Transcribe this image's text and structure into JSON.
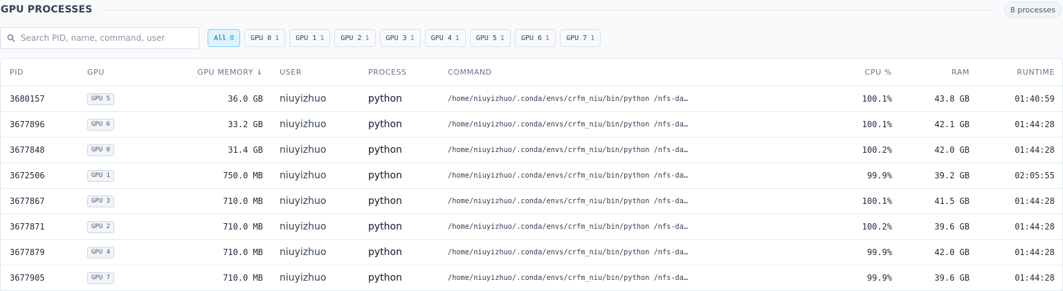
{
  "header": {
    "title": "GPU PROCESSES",
    "count_label": "8 processes"
  },
  "search": {
    "placeholder": "Search PID, name, command, user",
    "value": ""
  },
  "filters": [
    {
      "label": "All",
      "count": "8",
      "active": true
    },
    {
      "label": "GPU 0",
      "count": "1",
      "active": false
    },
    {
      "label": "GPU 1",
      "count": "1",
      "active": false
    },
    {
      "label": "GPU 2",
      "count": "1",
      "active": false
    },
    {
      "label": "GPU 3",
      "count": "1",
      "active": false
    },
    {
      "label": "GPU 4",
      "count": "1",
      "active": false
    },
    {
      "label": "GPU 5",
      "count": "1",
      "active": false
    },
    {
      "label": "GPU 6",
      "count": "1",
      "active": false
    },
    {
      "label": "GPU 7",
      "count": "1",
      "active": false
    }
  ],
  "table": {
    "columns": {
      "pid": "PID",
      "gpu": "GPU",
      "gpu_memory": "GPU MEMORY",
      "sort_indicator": "↓",
      "user": "USER",
      "process": "PROCESS",
      "command": "COMMAND",
      "cpu": "CPU %",
      "ram": "RAM",
      "runtime": "RUNTIME"
    },
    "rows": [
      {
        "pid": "3680157",
        "gpu": "GPU 5",
        "gpu_memory": "36.0 GB",
        "user": "niuyizhuo",
        "process": "python",
        "command": "/home/niuyizhuo/.conda/envs/crfm_niu/bin/python /nfs-da…",
        "cpu": "100.1%",
        "ram": "43.8 GB",
        "runtime": "01:40:59"
      },
      {
        "pid": "3677896",
        "gpu": "GPU 6",
        "gpu_memory": "33.2 GB",
        "user": "niuyizhuo",
        "process": "python",
        "command": "/home/niuyizhuo/.conda/envs/crfm_niu/bin/python /nfs-da…",
        "cpu": "100.1%",
        "ram": "42.1 GB",
        "runtime": "01:44:28"
      },
      {
        "pid": "3677848",
        "gpu": "GPU 0",
        "gpu_memory": "31.4 GB",
        "user": "niuyizhuo",
        "process": "python",
        "command": "/home/niuyizhuo/.conda/envs/crfm_niu/bin/python /nfs-da…",
        "cpu": "100.2%",
        "ram": "42.0 GB",
        "runtime": "01:44:28"
      },
      {
        "pid": "3672506",
        "gpu": "GPU 1",
        "gpu_memory": "750.0 MB",
        "user": "niuyizhuo",
        "process": "python",
        "command": "/home/niuyizhuo/.conda/envs/crfm_niu/bin/python /nfs-da…",
        "cpu": "99.9%",
        "ram": "39.2 GB",
        "runtime": "02:05:55"
      },
      {
        "pid": "3677867",
        "gpu": "GPU 3",
        "gpu_memory": "710.0 MB",
        "user": "niuyizhuo",
        "process": "python",
        "command": "/home/niuyizhuo/.conda/envs/crfm_niu/bin/python /nfs-da…",
        "cpu": "100.1%",
        "ram": "41.5 GB",
        "runtime": "01:44:28"
      },
      {
        "pid": "3677871",
        "gpu": "GPU 2",
        "gpu_memory": "710.0 MB",
        "user": "niuyizhuo",
        "process": "python",
        "command": "/home/niuyizhuo/.conda/envs/crfm_niu/bin/python /nfs-da…",
        "cpu": "100.2%",
        "ram": "39.6 GB",
        "runtime": "01:44:28"
      },
      {
        "pid": "3677879",
        "gpu": "GPU 4",
        "gpu_memory": "710.0 MB",
        "user": "niuyizhuo",
        "process": "python",
        "command": "/home/niuyizhuo/.conda/envs/crfm_niu/bin/python /nfs-da…",
        "cpu": "99.9%",
        "ram": "42.0 GB",
        "runtime": "01:44:28"
      },
      {
        "pid": "3677905",
        "gpu": "GPU 7",
        "gpu_memory": "710.0 MB",
        "user": "niuyizhuo",
        "process": "python",
        "command": "/home/niuyizhuo/.conda/envs/crfm_niu/bin/python /nfs-da…",
        "cpu": "99.9%",
        "ram": "39.6 GB",
        "runtime": "01:44:28"
      }
    ]
  },
  "colors": {
    "accent": "#0ea5e9",
    "active_chip_bg": "#e0f2fe",
    "border": "#e2e8f0"
  }
}
